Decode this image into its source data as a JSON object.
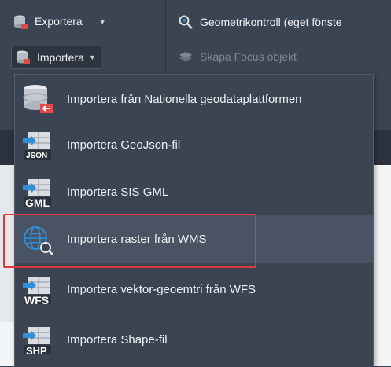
{
  "ribbon": {
    "export_label": "Exportera ",
    "import_label": "Importera",
    "geometry_label": "Geometrikontroll (eget fönste",
    "focus_label": "Skapa Focus objekt"
  },
  "menu": {
    "items": [
      {
        "label": "Importera från Nationella geodataplattformen",
        "icon": "database-import-icon"
      },
      {
        "label": "Importera GeoJson-fil",
        "icon": "json-file-icon",
        "tag": "JSON"
      },
      {
        "label": "Importera SIS GML",
        "icon": "gml-file-icon",
        "tag": "GML"
      },
      {
        "label": "Importera raster från WMS",
        "icon": "globe-search-icon"
      },
      {
        "label": "Importera vektor-geoemtri från WFS",
        "icon": "wfs-file-icon",
        "tag": "WFS"
      },
      {
        "label": "Importera Shape-fil",
        "icon": "shp-file-icon",
        "tag": "SHP"
      }
    ]
  },
  "colors": {
    "highlight": "#e03a3a",
    "accent_blue": "#2f8fd8"
  }
}
